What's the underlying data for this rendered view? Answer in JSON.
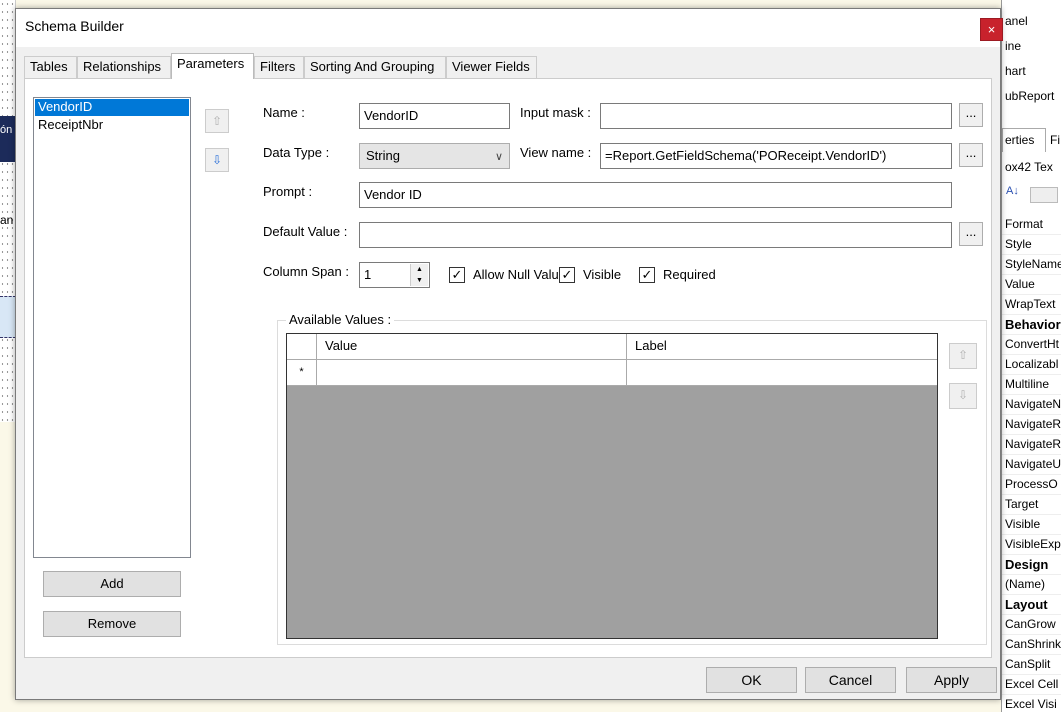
{
  "background": {
    "left_labels": [
      "ón",
      "an"
    ],
    "right_header": [
      "anel",
      "ine",
      "hart",
      "ubReport",
      "erties",
      "Fi",
      "ox42 Tex"
    ],
    "right_properties": [
      {
        "name": "Format",
        "bold": false
      },
      {
        "name": "Style",
        "bold": false
      },
      {
        "name": "StyleName",
        "bold": false
      },
      {
        "name": "Value",
        "bold": false
      },
      {
        "name": "WrapText",
        "bold": false
      },
      {
        "name": "Behavior",
        "bold": true
      },
      {
        "name": "ConvertHt",
        "bold": false
      },
      {
        "name": "Localizabl",
        "bold": false
      },
      {
        "name": "Multiline",
        "bold": false
      },
      {
        "name": "NavigateN",
        "bold": false
      },
      {
        "name": "NavigateR",
        "bold": false
      },
      {
        "name": "NavigateR",
        "bold": false
      },
      {
        "name": "NavigateU",
        "bold": false
      },
      {
        "name": "ProcessO",
        "bold": false
      },
      {
        "name": "Target",
        "bold": false
      },
      {
        "name": "Visible",
        "bold": false
      },
      {
        "name": "VisibleExp",
        "bold": false
      },
      {
        "name": "Design",
        "bold": true
      },
      {
        "name": "(Name)",
        "bold": false
      },
      {
        "name": "Layout",
        "bold": true
      },
      {
        "name": "CanGrow",
        "bold": false
      },
      {
        "name": "CanShrink",
        "bold": false
      },
      {
        "name": "CanSplit",
        "bold": false
      },
      {
        "name": "Excel Cell",
        "bold": false
      },
      {
        "name": "Excel Visi",
        "bold": false
      }
    ]
  },
  "dialog": {
    "title": "Schema Builder",
    "close_glyph": "×",
    "tabs": [
      "Tables",
      "Relationships",
      "Parameters",
      "Filters",
      "Sorting And Grouping",
      "Viewer Fields"
    ],
    "active_tab": "Parameters"
  },
  "parameters": {
    "list": [
      "VendorID",
      "ReceiptNbr"
    ],
    "selected": "VendorID",
    "add_label": "Add",
    "remove_label": "Remove",
    "move_up_glyph": "⇧",
    "move_down_glyph": "⇩"
  },
  "form": {
    "name_label": "Name :",
    "name_value": "VendorID",
    "input_mask_label": "Input mask :",
    "input_mask_value": "",
    "data_type_label": "Data Type :",
    "data_type_value": "String",
    "view_name_label": "View name :",
    "view_name_value": "=Report.GetFieldSchema('POReceipt.VendorID')",
    "prompt_label": "Prompt :",
    "prompt_value": "Vendor ID",
    "default_value_label": "Default Value :",
    "default_value_value": "",
    "column_span_label": "Column Span :",
    "column_span_value": "1",
    "allow_null_label": "Allow Null Valu",
    "allow_null_checked": true,
    "visible_label": "Visible",
    "visible_checked": true,
    "required_label": "Required",
    "required_checked": true,
    "ellipsis": "...",
    "check_glyph": "✓",
    "chevron_glyph": "∨",
    "spin_up_glyph": "▲",
    "spin_down_glyph": "▼"
  },
  "available_values": {
    "title": "Available Values :",
    "columns": [
      "Value",
      "Label"
    ],
    "new_row_marker": "*",
    "row_up_glyph": "⇧",
    "row_down_glyph": "⇩"
  },
  "footer": {
    "ok": "OK",
    "cancel": "Cancel",
    "apply": "Apply"
  }
}
